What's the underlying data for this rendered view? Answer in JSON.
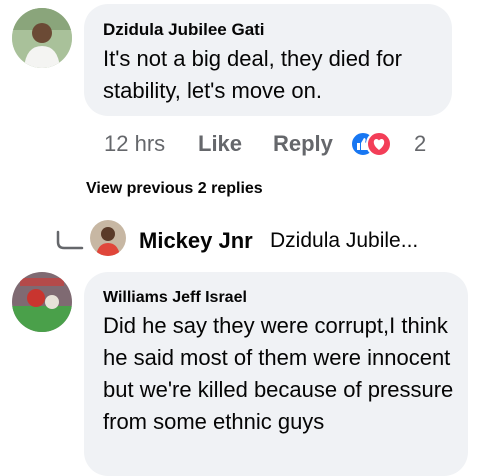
{
  "comments": [
    {
      "author": "Dzidula Jubilee Gati",
      "text": "It's not a big deal, they died for stability, let's move on.",
      "time": "12 hrs",
      "like_label": "Like",
      "reply_label": "Reply",
      "reaction_count": "2",
      "reaction_icons": [
        "like-icon",
        "love-icon"
      ]
    },
    {
      "author": "Williams Jeff Israel",
      "text": "Did he say they were corrupt,I think he said most of them were innocent but we're killed because of pressure from some ethnic guys"
    }
  ],
  "replies_section": {
    "view_previous": "View previous 2 replies",
    "latest_reply": {
      "author": "Mickey Jnr",
      "snippet": "Dzidula Jubile..."
    }
  },
  "colors": {
    "bubble": "#f0f2f5",
    "meta_text": "#65676b",
    "like_blue": "#1877f2",
    "love_red": "#f33e58"
  }
}
